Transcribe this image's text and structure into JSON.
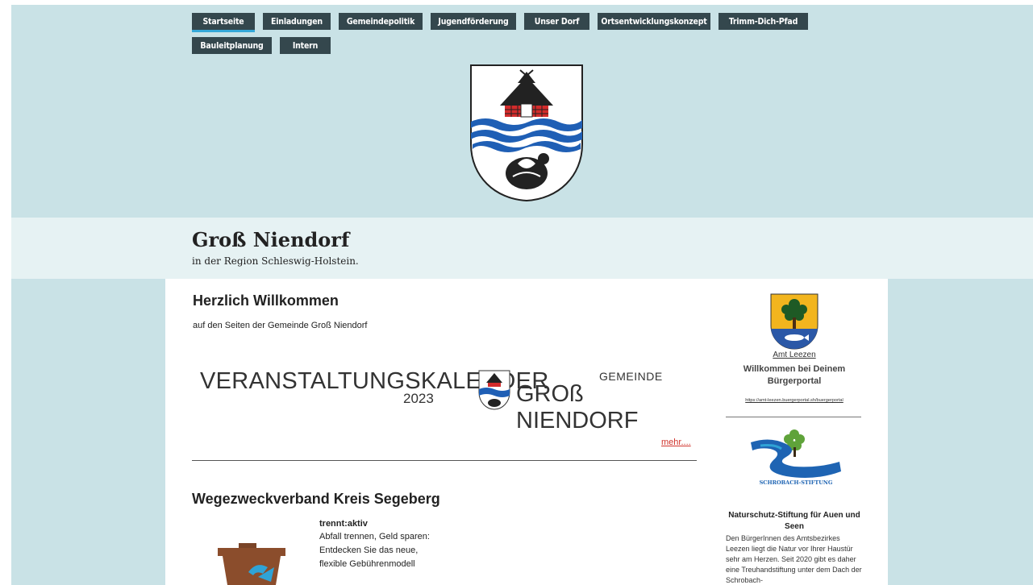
{
  "nav": {
    "row1": [
      {
        "label": "Startseite",
        "active": true,
        "w": 78
      },
      {
        "label": "Einladungen",
        "w": 84
      },
      {
        "label": "Gemeindepolitik",
        "w": 104
      },
      {
        "label": "Jugendförderung",
        "w": 106
      },
      {
        "label": "Unser Dorf",
        "w": 81
      },
      {
        "label": "Ortsentwicklungskonzept",
        "w": 140
      },
      {
        "label": "Trimm-Dich-Pfad",
        "w": 111
      }
    ],
    "row2": [
      {
        "label": "Bauleitplanung",
        "w": 99
      },
      {
        "label": "Intern",
        "w": 63
      }
    ]
  },
  "site": {
    "title": "Groß Niendorf",
    "subtitle": "in der Region Schleswig-Holstein."
  },
  "welcome": {
    "heading": "Herzlich Willkommen",
    "text": "auf den Seiten der Gemeinde Groß Niendorf"
  },
  "banner": {
    "main": "VERANSTALTUNGSKALENDER",
    "year": "2023",
    "gemeinde": "GEMEINDE",
    "name": "GROß NIENDORF"
  },
  "more_link": "mehr....",
  "wege": {
    "heading": "Wegezweckverband Kreis Segeberg",
    "title": "trennt:aktiv",
    "lines": [
      "Abfall trennen, Geld sparen:",
      "Entdecken Sie das neue,",
      "flexible Gebührenmodell"
    ]
  },
  "sidebar": {
    "amt_link": "Amt Leezen",
    "amt_welcome": "Willkommen bei Deinem Bürgerportal",
    "amt_url": "https://amt-leezen.buergerportal.sh/buergerportal",
    "schro_logo_text": "SCHROBACH-STIFTUNG",
    "schro_title": "Naturschutz-Stiftung für Auen und Seen",
    "schro_text": "Den BürgerInnen des Amtsbezirkes Leezen liegt die Natur vor Ihrer Haustür sehr am Herzen. Seit 2020 gibt es daher eine Treuhandstiftung unter dem Dach der Schrobach-"
  },
  "colors": {
    "header_bg": "#c9e2e6",
    "nav_bg": "#34474d",
    "nav_active_underline": "#35a8d8",
    "link_red": "#d0342c"
  }
}
